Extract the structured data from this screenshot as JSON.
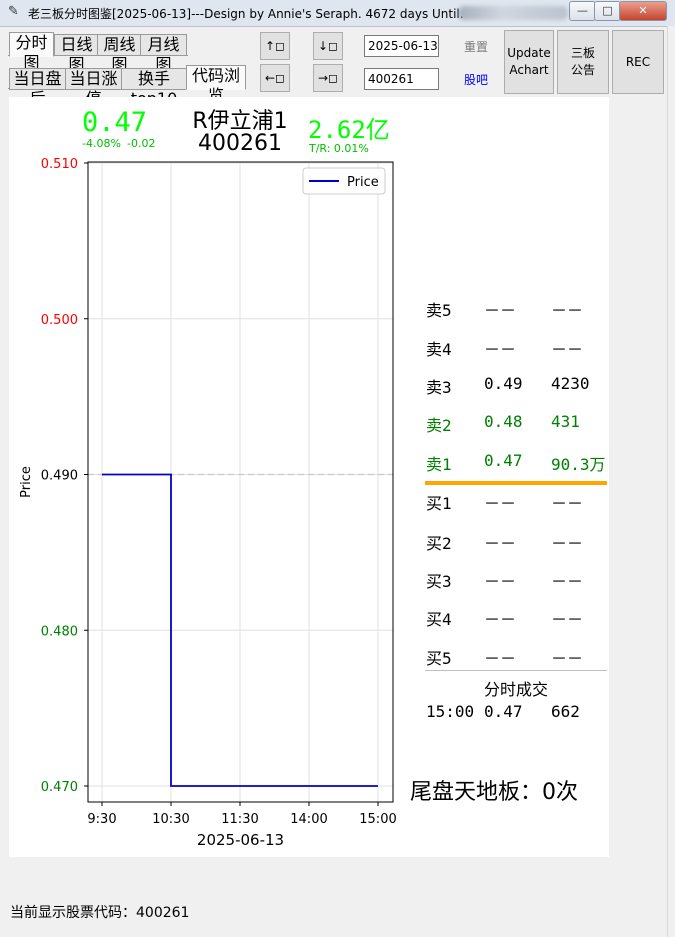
{
  "window": {
    "title": "老三板分时图鉴[2025-06-13]---Design by Annie's Seraph.  4672 days Until.",
    "controls": [
      "—",
      "□",
      "✕"
    ]
  },
  "tabs_row1": [
    {
      "label": "分时图",
      "selected": true
    },
    {
      "label": "日线图",
      "selected": false
    },
    {
      "label": "周线图",
      "selected": false
    },
    {
      "label": "月线图",
      "selected": false
    }
  ],
  "tabs_row2": [
    {
      "label": "当日盘后",
      "selected": false
    },
    {
      "label": "当日涨停",
      "selected": false
    },
    {
      "label": "换手top10",
      "selected": false
    },
    {
      "label": "代码浏览",
      "selected": true
    }
  ],
  "nav": {
    "up": "↑◻",
    "down": "↓◻",
    "left": "←◻",
    "right": "→◻"
  },
  "inputs": {
    "date": "2025-06-13",
    "code": "400261"
  },
  "links": {
    "reset": "重置",
    "stock_bar": "股吧"
  },
  "buttons": {
    "update_achart": "Update Achart",
    "sanban_notice": "三板 公告",
    "rec": "REC"
  },
  "quote": {
    "price": "0.47",
    "change_pct": "-4.08%",
    "change": "-0.02",
    "name": "R伊立浦1",
    "code": "400261",
    "amount": "2.62亿",
    "turnover": "T/R: 0.01%"
  },
  "chart_data": {
    "type": "line",
    "series": [
      {
        "name": "Price",
        "x": [
          "9:30",
          "10:30",
          "10:30",
          "15:00"
        ],
        "values": [
          0.49,
          0.49,
          0.47,
          0.47
        ]
      }
    ],
    "reference_line": 0.49,
    "x_ticks": [
      "9:30",
      "10:30",
      "11:30",
      "14:00",
      "15:00"
    ],
    "y_ticks": [
      "0.510",
      "0.500",
      "0.490",
      "0.480",
      "0.470"
    ],
    "ylim": [
      0.47,
      0.51
    ],
    "xlabel": "2025-06-13",
    "ylabel": "Price",
    "legend": "Price",
    "legend_position": "top-right",
    "grid": true,
    "colors": {
      "line": "#0000cc",
      "up": "#ff0000",
      "down": "#008000",
      "neutral": "#000000",
      "ref": "#c8c8c8"
    }
  },
  "order_book": {
    "sell": [
      {
        "label": "卖5",
        "price": "－－",
        "vol": "－－"
      },
      {
        "label": "卖4",
        "price": "－－",
        "vol": "－－"
      },
      {
        "label": "卖3",
        "price": "0.49",
        "vol": "4230"
      },
      {
        "label": "卖2",
        "price": "0.48",
        "vol": "431"
      },
      {
        "label": "卖1",
        "price": "0.47",
        "vol": "90.3万"
      }
    ],
    "buy": [
      {
        "label": "买1",
        "price": "－－",
        "vol": "－－"
      },
      {
        "label": "买2",
        "price": "－－",
        "vol": "－－"
      },
      {
        "label": "买3",
        "price": "－－",
        "vol": "－－"
      },
      {
        "label": "买4",
        "price": "－－",
        "vol": "－－"
      },
      {
        "label": "买5",
        "price": "－－",
        "vol": "－－"
      }
    ],
    "colors": {
      "sell_green": "#008000",
      "divider": "#ffa500"
    }
  },
  "trades": {
    "title": "分时成交",
    "rows": [
      {
        "time": "15:00",
        "price": "0.47",
        "vol": "662"
      }
    ]
  },
  "tail_note": "尾盘天地板：0次",
  "status_bar": "当前显示股票代码：400261"
}
